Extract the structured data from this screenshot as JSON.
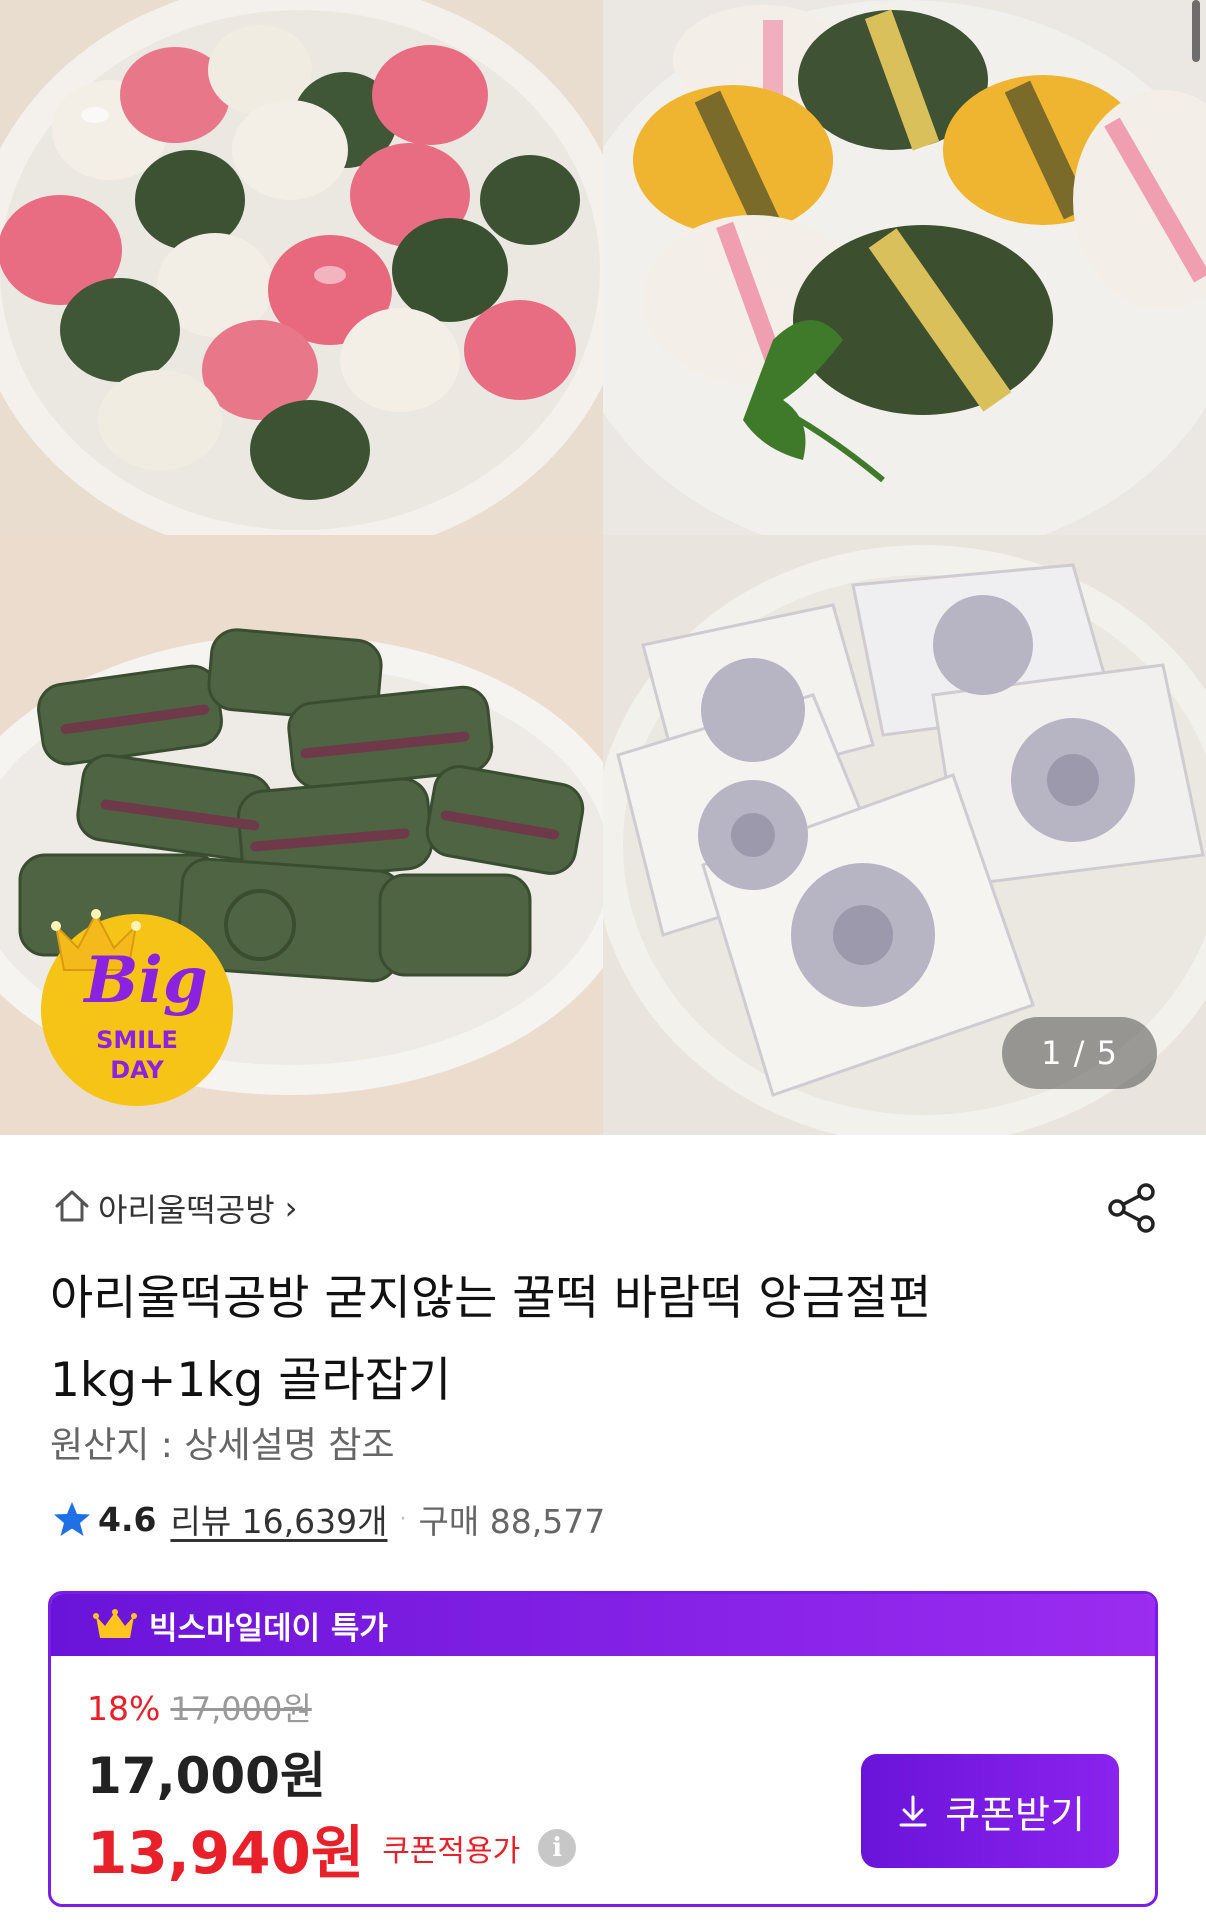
{
  "gallery": {
    "counter": "1 / 5",
    "badge": {
      "word": "Big",
      "line1": "SMILE",
      "line2": "DAY"
    }
  },
  "store": {
    "name": "아리울떡공방",
    "chevron": "›"
  },
  "product": {
    "title": "아리울떡공방 굳지않는 꿀떡 바람떡 앙금절편 1kg+1kg 골라잡기",
    "origin": "원산지 : 상세설명 참조",
    "rating": "4.6",
    "review_label": "리뷰 16,639개",
    "separator": "·",
    "purchase_label": "구매 88,577"
  },
  "deal": {
    "label": "빅스마일데이 특가",
    "discount_pct": "18%",
    "original_price": "17,000원",
    "price": "17,000원",
    "coupon_price": "13,940원",
    "coupon_applied": "쿠폰적용가",
    "coupon_button": "쿠폰받기",
    "accent": "#7b1de8",
    "sale_color": "#e8202a"
  }
}
